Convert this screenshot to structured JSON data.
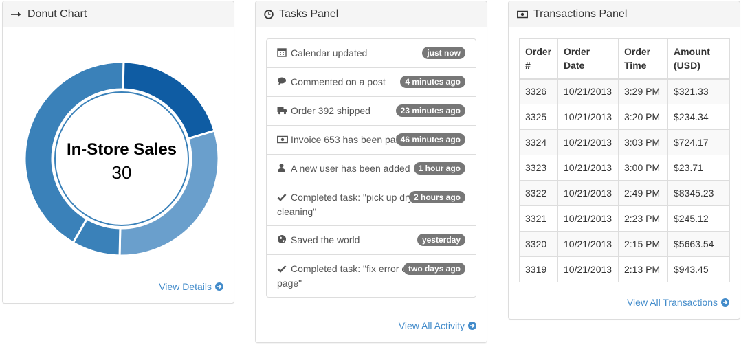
{
  "donut_panel": {
    "title": "Donut Chart",
    "link": "View Details",
    "center_title": "In-Store Sales",
    "center_value": "30"
  },
  "chart_data": {
    "type": "pie",
    "values": [
      {
        "value": 42,
        "color": "#3a81b9"
      },
      {
        "value": 20,
        "color": "#0f5ca3"
      },
      {
        "value": 30,
        "color": "#6a9fcc"
      },
      {
        "value": 8,
        "color": "#3a81b9"
      }
    ]
  },
  "tasks_panel": {
    "title": "Tasks Panel",
    "link": "View All Activity",
    "items": [
      {
        "icon": "calendar-icon",
        "text": "Calendar updated",
        "badge": "just now"
      },
      {
        "icon": "comment-icon",
        "text": "Commented on a post",
        "badge": "4 minutes ago"
      },
      {
        "icon": "truck-icon",
        "text": "Order 392 shipped",
        "badge": "23 minutes ago"
      },
      {
        "icon": "money-icon",
        "text": "Invoice 653 has been paid",
        "badge": "46 minutes ago"
      },
      {
        "icon": "user-icon",
        "text": "A new user has been added",
        "badge": "1 hour ago"
      },
      {
        "icon": "check-icon",
        "text": "Completed task: \"pick up dry cleaning\"",
        "badge": "2 hours ago"
      },
      {
        "icon": "globe-icon",
        "text": "Saved the world",
        "badge": "yesterday"
      },
      {
        "icon": "check-icon",
        "text": "Completed task: \"fix error on sales page\"",
        "badge": "two days ago"
      }
    ]
  },
  "transactions_panel": {
    "title": "Transactions Panel",
    "link": "View All Transactions",
    "headers": [
      "Order #",
      "Order Date",
      "Order Time",
      "Amount (USD)"
    ],
    "rows": [
      [
        "3326",
        "10/21/2013",
        "3:29 PM",
        "$321.33"
      ],
      [
        "3325",
        "10/21/2013",
        "3:20 PM",
        "$234.34"
      ],
      [
        "3324",
        "10/21/2013",
        "3:03 PM",
        "$724.17"
      ],
      [
        "3323",
        "10/21/2013",
        "3:00 PM",
        "$23.71"
      ],
      [
        "3322",
        "10/21/2013",
        "2:49 PM",
        "$8345.23"
      ],
      [
        "3321",
        "10/21/2013",
        "2:23 PM",
        "$245.12"
      ],
      [
        "3320",
        "10/21/2013",
        "2:15 PM",
        "$5663.54"
      ],
      [
        "3319",
        "10/21/2013",
        "2:13 PM",
        "$943.45"
      ]
    ]
  }
}
